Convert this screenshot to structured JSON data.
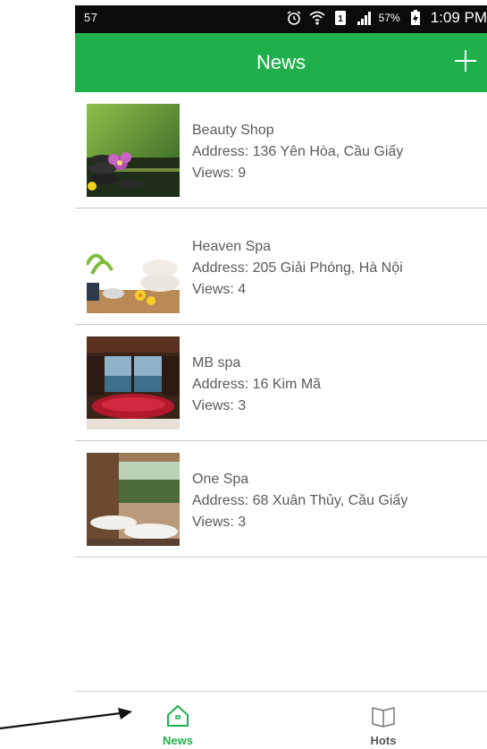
{
  "status_bar": {
    "notification": "57",
    "battery_percent": "57%",
    "time": "1:09 PM",
    "icons": [
      "alarm-icon",
      "wifi-icon",
      "sim-icon",
      "signal-icon",
      "battery-icon"
    ]
  },
  "app_bar": {
    "title": "News",
    "action_icon": "plus-icon",
    "color": "#1fb04b"
  },
  "items": [
    {
      "name": "Beauty Shop",
      "address": "Address: 136 Yên Hòa, Cầu Giấy",
      "views": "Views: 9"
    },
    {
      "name": "Heaven Spa",
      "address": "Address: 205 Giải Phóng, Hà Nội",
      "views": "Views: 4"
    },
    {
      "name": "MB spa",
      "address": "Address: 16 Kim Mã",
      "views": "Views: 3"
    },
    {
      "name": "One Spa",
      "address": "Address: 68 Xuân Thủy, Cầu Giấy",
      "views": "Views: 3"
    }
  ],
  "bottom_nav": {
    "news_label": "News",
    "news_icon": "home-icon",
    "hots_label": "Hots",
    "hots_icon": "book-icon",
    "active": "News"
  }
}
